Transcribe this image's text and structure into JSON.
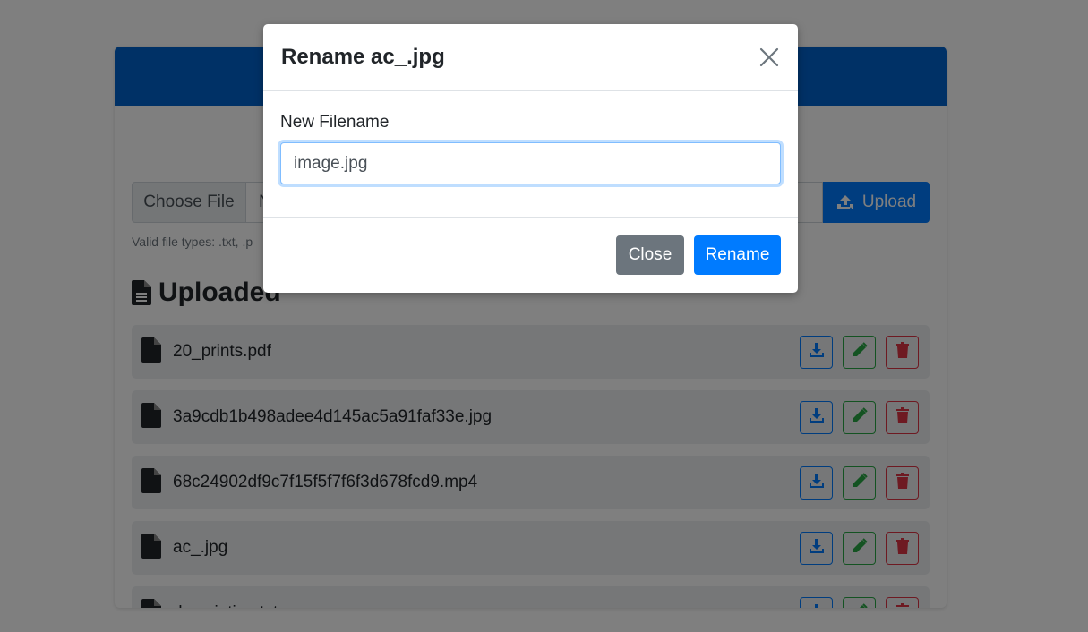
{
  "page": {
    "choose_file_label": "Choose File",
    "file_label_value": "N",
    "upload_label": "Upload",
    "help_text": "Valid file types: .txt, .p",
    "section_title": "Uploaded",
    "files": [
      {
        "name": "20_prints.pdf"
      },
      {
        "name": "3a9cdb1b498adee4d145ac5a91faf33e.jpg"
      },
      {
        "name": "68c24902df9c7f15f5f7f6f3d678fcd9.mp4"
      },
      {
        "name": "ac_.jpg"
      },
      {
        "name": "description.txt"
      }
    ]
  },
  "modal": {
    "title": "Rename ac_.jpg",
    "field_label": "New Filename",
    "input_value": "image.jpg",
    "close_label": "Close",
    "rename_label": "Rename"
  },
  "icons": {
    "file": "file-icon",
    "download": "download-icon",
    "edit": "pencil-icon",
    "delete": "trash-icon",
    "upload": "upload-icon",
    "close": "close-icon"
  },
  "colors": {
    "primary": "#007bff",
    "header": "#0062cc",
    "success": "#28a745",
    "danger": "#dc3545",
    "secondary": "#6c757d"
  }
}
